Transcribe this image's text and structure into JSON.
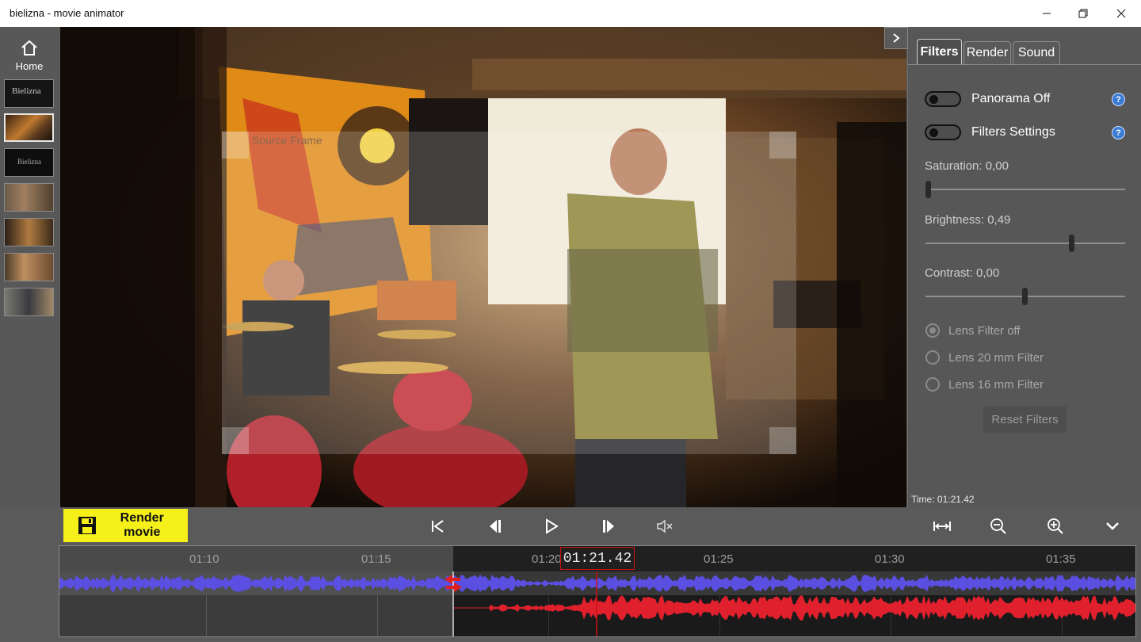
{
  "window": {
    "title": "bielizna - movie animator"
  },
  "window_controls": {
    "minimize": "minimize",
    "maximize": "maximize",
    "close": "close"
  },
  "sidebar": {
    "home_label": "Home",
    "thumbnails": [
      {
        "label": "Bielizna"
      },
      {
        "label": ""
      },
      {
        "label": "Bielizna"
      },
      {
        "label": ""
      },
      {
        "label": ""
      },
      {
        "label": ""
      },
      {
        "label": ""
      }
    ]
  },
  "video": {
    "overlay_label": "Source Frame"
  },
  "panel": {
    "tabs": [
      {
        "label": "Filters",
        "active": true
      },
      {
        "label": "Render",
        "active": false
      },
      {
        "label": "Sound",
        "active": false
      }
    ],
    "toggles": [
      {
        "label": "Panorama Off",
        "on": false
      },
      {
        "label": "Filters Settings",
        "on": false
      }
    ],
    "sliders": [
      {
        "label": "Saturation: 0,00",
        "value": 0.0
      },
      {
        "label": "Brightness: 0,49",
        "value": 0.49
      },
      {
        "label": "Contrast: 0,00",
        "value": 0.0
      }
    ],
    "radios": [
      {
        "label": "Lens Filter off",
        "checked": true
      },
      {
        "label": "Lens 20 mm Filter",
        "checked": false
      },
      {
        "label": "Lens 16 mm Filter",
        "checked": false
      }
    ],
    "reset_label": "Reset Filters",
    "time_label": "Time: 01:21.42"
  },
  "toolbar": {
    "render_label": "Render movie",
    "transport": [
      "skip-to-start",
      "step-back",
      "play",
      "step-forward",
      "mute"
    ],
    "view": [
      "fit-width",
      "zoom-out",
      "zoom-in",
      "collapse"
    ]
  },
  "timeline": {
    "current_time": "01:21.42",
    "ticks": [
      "01:10",
      "01:15",
      "01:20",
      "01:25",
      "01:30",
      "01:35"
    ]
  },
  "colors": {
    "accent_yellow": "#f5ef1a",
    "waveform_blue": "#5a4fe0",
    "waveform_red": "#e0202c",
    "playhead": "#cc1111"
  }
}
